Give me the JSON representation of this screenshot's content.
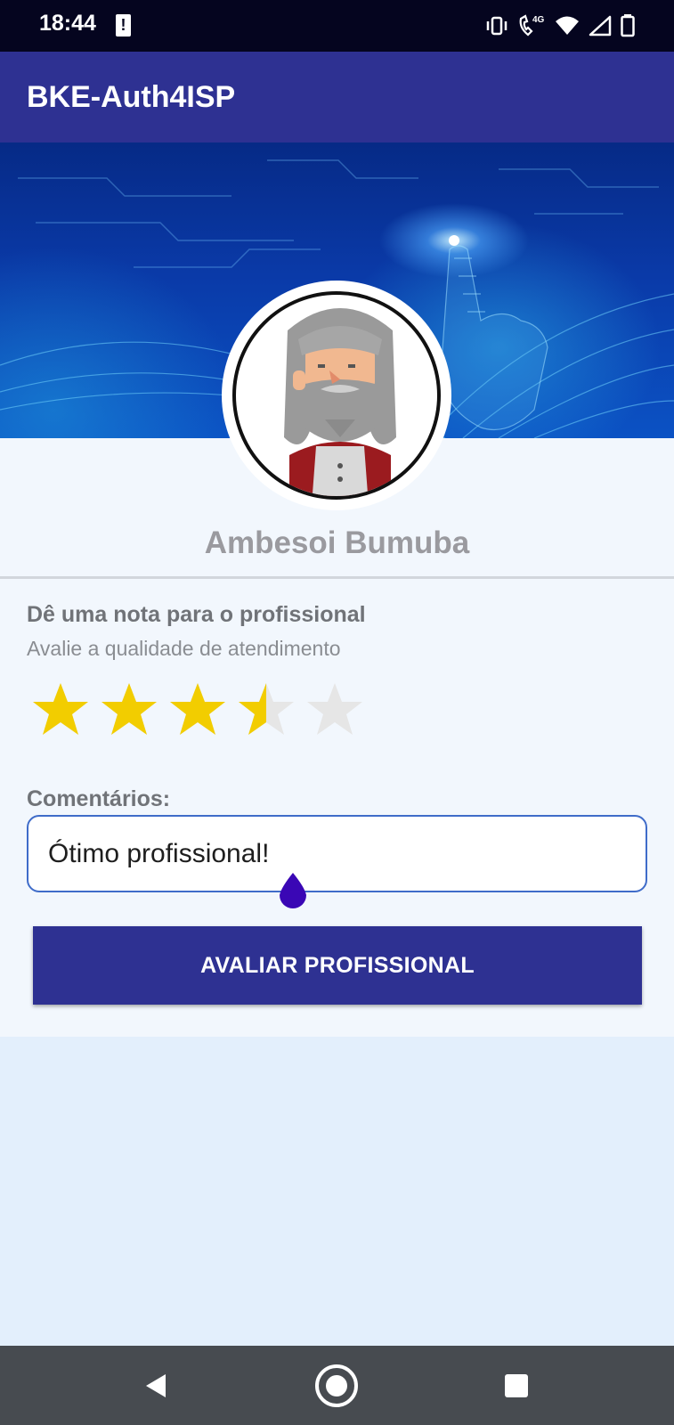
{
  "status_bar": {
    "time": "18:44",
    "alert_glyph": "!",
    "network": "4G",
    "icons": [
      "alert-icon",
      "vibrate-icon",
      "wifi-calling-icon",
      "wifi-icon",
      "signal-icon",
      "battery-icon"
    ]
  },
  "app_bar": {
    "title": "BKE-Auth4ISP"
  },
  "profile": {
    "name": "Ambesoi Bumuba"
  },
  "rating": {
    "title": "Dê uma nota para o profissional",
    "subtitle": "Avalie a qualidade de atendimento",
    "value": 3.5,
    "max": 5
  },
  "comments": {
    "label": "Comentários:",
    "value": "Ótimo profissional!"
  },
  "submit": {
    "label": "AVALIAR PROFISSIONAL"
  },
  "nav": {
    "icons": [
      "back-icon",
      "home-icon",
      "recents-icon"
    ]
  },
  "colors": {
    "primary": "#2e3192",
    "star_filled": "#f2cd00",
    "star_empty": "#e6e6e6",
    "cursor_handle": "#3a07b5"
  }
}
